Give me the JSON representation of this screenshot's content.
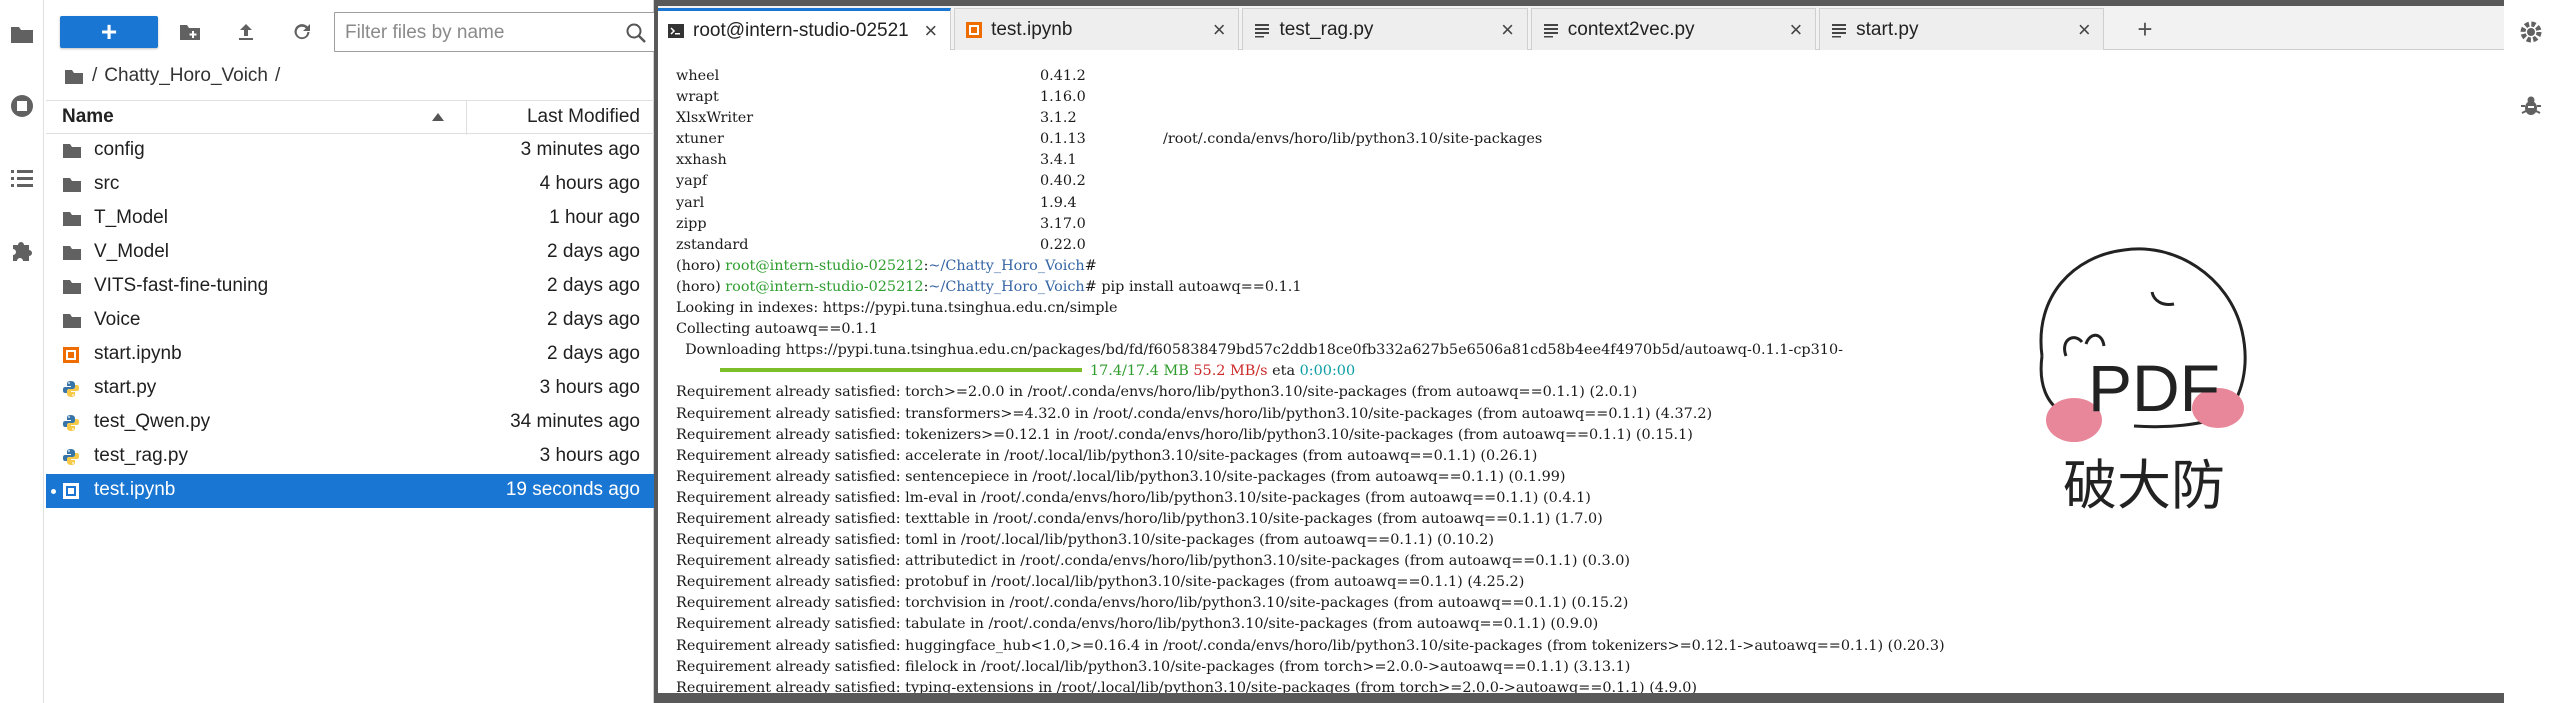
{
  "file_browser": {
    "new_button_label": "+",
    "filter_placeholder": "Filter files by name",
    "breadcrumb": [
      "/",
      "Chatty_Horo_Voich",
      "/"
    ],
    "header_name": "Name",
    "header_modified": "Last Modified",
    "files": [
      {
        "name": "config",
        "modified": "3 minutes ago",
        "icon": "folder-icon"
      },
      {
        "name": "src",
        "modified": "4 hours ago",
        "icon": "folder-icon"
      },
      {
        "name": "T_Model",
        "modified": "1 hour ago",
        "icon": "folder-icon"
      },
      {
        "name": "V_Model",
        "modified": "2 days ago",
        "icon": "folder-icon"
      },
      {
        "name": "VITS-fast-fine-tuning",
        "modified": "2 days ago",
        "icon": "folder-icon"
      },
      {
        "name": "Voice",
        "modified": "2 days ago",
        "icon": "folder-icon"
      },
      {
        "name": "start.ipynb",
        "modified": "2 days ago",
        "icon": "notebook-icon"
      },
      {
        "name": "start.py",
        "modified": "3 hours ago",
        "icon": "python-icon"
      },
      {
        "name": "test_Qwen.py",
        "modified": "34 minutes ago",
        "icon": "python-icon"
      },
      {
        "name": "test_rag.py",
        "modified": "3 hours ago",
        "icon": "python-icon"
      },
      {
        "name": "test.ipynb",
        "modified": "19 seconds ago",
        "icon": "notebook-icon",
        "selected": true
      }
    ]
  },
  "tabs": [
    {
      "label": "root@intern-studio-02521",
      "icon": "terminal-icon",
      "active": true
    },
    {
      "label": "test.ipynb",
      "icon": "notebook-icon",
      "active": false
    },
    {
      "label": "test_rag.py",
      "icon": "text-file-icon",
      "active": false
    },
    {
      "label": "context2vec.py",
      "icon": "text-file-icon",
      "active": false
    },
    {
      "label": "start.py",
      "icon": "text-file-icon",
      "active": false
    }
  ],
  "terminal": {
    "packages": [
      {
        "name": "wheel",
        "version": "0.41.2",
        "location": ""
      },
      {
        "name": "wrapt",
        "version": "1.16.0",
        "location": ""
      },
      {
        "name": "XlsxWriter",
        "version": "3.1.2",
        "location": ""
      },
      {
        "name": "xtuner",
        "version": "0.1.13",
        "location": "/root/.conda/envs/horo/lib/python3.10/site-packages"
      },
      {
        "name": "xxhash",
        "version": "3.4.1",
        "location": ""
      },
      {
        "name": "yapf",
        "version": "0.40.2",
        "location": ""
      },
      {
        "name": "yarl",
        "version": "1.9.4",
        "location": ""
      },
      {
        "name": "zipp",
        "version": "3.17.0",
        "location": ""
      },
      {
        "name": "zstandard",
        "version": "0.22.0",
        "location": ""
      }
    ],
    "prompt_env": "(horo) ",
    "prompt_user": "root@intern-studio-025212",
    "prompt_colon": ":",
    "prompt_path": "~/Chatty_Horo_Voich",
    "prompt_hash": "#",
    "command": " pip install autoawq==0.1.1",
    "looking": "Looking in indexes: https://pypi.tuna.tsinghua.edu.cn/simple",
    "collecting": "Collecting autoawq==0.1.1",
    "downloading": "  Downloading https://pypi.tuna.tsinghua.edu.cn/packages/bd/fd/f605838479bd57c2ddb18ce0fb332a627b5e6506a81cd58b4ee4f4970b5d/autoawq-0.1.1-cp310-",
    "progress_size": "17.4/17.4 MB",
    "progress_speed": "55.2 MB/s",
    "progress_eta_label": "eta",
    "progress_eta": "0:00:00",
    "requirements": [
      "Requirement already satisfied: torch>=2.0.0 in /root/.conda/envs/horo/lib/python3.10/site-packages (from autoawq==0.1.1) (2.0.1)",
      "Requirement already satisfied: transformers>=4.32.0 in /root/.conda/envs/horo/lib/python3.10/site-packages (from autoawq==0.1.1) (4.37.2)",
      "Requirement already satisfied: tokenizers>=0.12.1 in /root/.conda/envs/horo/lib/python3.10/site-packages (from autoawq==0.1.1) (0.15.1)",
      "Requirement already satisfied: accelerate in /root/.local/lib/python3.10/site-packages (from autoawq==0.1.1) (0.26.1)",
      "Requirement already satisfied: sentencepiece in /root/.local/lib/python3.10/site-packages (from autoawq==0.1.1) (0.1.99)",
      "Requirement already satisfied: lm-eval in /root/.conda/envs/horo/lib/python3.10/site-packages (from autoawq==0.1.1) (0.4.1)",
      "Requirement already satisfied: texttable in /root/.conda/envs/horo/lib/python3.10/site-packages (from autoawq==0.1.1) (1.7.0)",
      "Requirement already satisfied: toml in /root/.local/lib/python3.10/site-packages (from autoawq==0.1.1) (0.10.2)",
      "Requirement already satisfied: attributedict in /root/.conda/envs/horo/lib/python3.10/site-packages (from autoawq==0.1.1) (0.3.0)",
      "Requirement already satisfied: protobuf in /root/.local/lib/python3.10/site-packages (from autoawq==0.1.1) (4.25.2)",
      "Requirement already satisfied: torchvision in /root/.conda/envs/horo/lib/python3.10/site-packages (from autoawq==0.1.1) (0.15.2)",
      "Requirement already satisfied: tabulate in /root/.conda/envs/horo/lib/python3.10/site-packages (from autoawq==0.1.1) (0.9.0)",
      "Requirement already satisfied: huggingface_hub<1.0,>=0.16.4 in /root/.conda/envs/horo/lib/python3.10/site-packages (from tokenizers>=0.12.1->autoawq==0.1.1) (0.20.3)",
      "Requirement already satisfied: filelock in /root/.local/lib/python3.10/site-packages (from torch>=2.0.0->autoawq==0.1.1) (3.13.1)",
      "Requirement already satisfied: typing-extensions in /root/.local/lib/python3.10/site-packages (from torch>=2.0.0->autoawq==0.1.1) (4.9.0)"
    ]
  },
  "pdf_badge": {
    "title": "PDF",
    "subtitle": "破大防"
  },
  "colors": {
    "accent": "#1976d2",
    "frame": "#595959",
    "prompt_green": "#2e9d2e",
    "prompt_blue": "#3465a4"
  }
}
